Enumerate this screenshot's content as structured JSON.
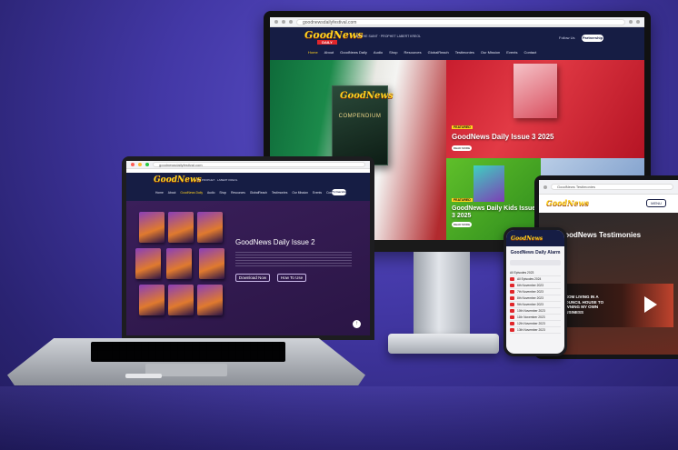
{
  "monitor": {
    "url": "goodnewsdailyfestival.com",
    "logo": "GoodNews",
    "logo_sub": "DAILY",
    "tagline": "BY THE SAINT · PROPHET LABERT KREOL",
    "follow": "Follow Us",
    "partnership": "Partnership",
    "nav": [
      "Home",
      "About",
      "GoodNews Daily",
      "Audio",
      "Shop",
      "Resources",
      "GlobalReach",
      "Testimonies",
      "Our Mission",
      "Events",
      "Contact"
    ],
    "cover_text": "GoodNews",
    "cover_sub": "COMPENDIUM",
    "hero_tag": "FEATURED",
    "hero_title": "GoodNews Daily Issue 3 2025",
    "hero_btn": "READ MORE",
    "kids_tag": "FEATURED",
    "kids_title": "GoodNews Daily Kids Issue 3 2025",
    "kids_btn": "READ MORE"
  },
  "laptop": {
    "url": "goodnewsdailyfestival.com",
    "logo": "GoodNews",
    "tagline": "BY PROPHET · LABERT KREOL",
    "partnership": "Partnership",
    "nav": [
      "Home",
      "About",
      "GoodNews Daily",
      "Audio",
      "Shop",
      "Resources",
      "GlobalReach",
      "Testimonies",
      "Our Mission",
      "Events",
      "Contact"
    ],
    "heading": "GoodNews Daily Issue 2",
    "download_btn": "Download Now",
    "listen_btn": "How To Use"
  },
  "tablet": {
    "title": "GoodNews Testimonies",
    "logo": "GoodNews",
    "menu": "MENU",
    "video_text": "FROM LIVING IN A COUNCIL HOUSE TO OWNING MY OWN BUSINESS"
  },
  "phone": {
    "logo": "GoodNews",
    "title": "GoodNews Daily Alarm",
    "rows": [
      "All Episodes 2023",
      "All Episodes 2024",
      "6th November 2023",
      "7th November 2023",
      "8th November 2023",
      "9th November 2023",
      "10th November 2023",
      "11th November 2023",
      "12th November 2023",
      "13th November 2023"
    ]
  },
  "colors": {
    "brand_navy": "#161d44",
    "logo_yellow": "#ffd21f",
    "logo_red": "#e0262b",
    "background": "#4338a6"
  }
}
